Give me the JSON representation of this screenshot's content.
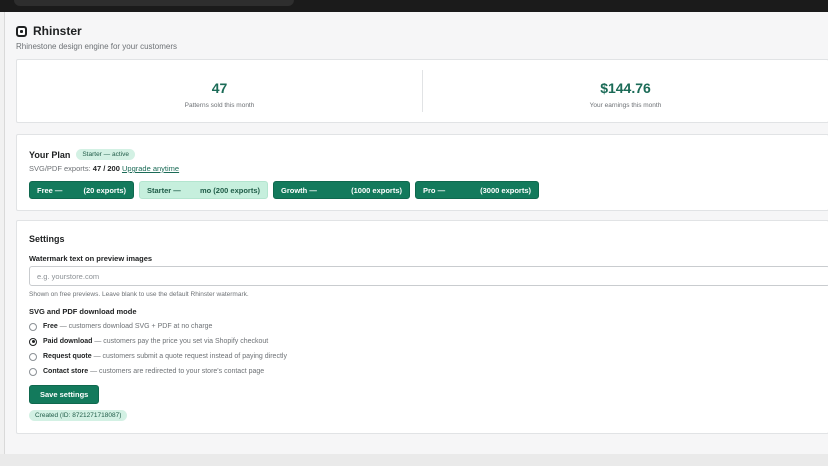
{
  "app": {
    "title": "Rhinster",
    "subtitle": "Rhinestone design engine for your customers"
  },
  "stats": [
    {
      "value": "47",
      "label": "Patterns sold this month"
    },
    {
      "value": "$144.76",
      "label": "Your earnings this month"
    }
  ],
  "plan": {
    "title": "Your Plan",
    "badge": "Starter — active",
    "exports_prefix": "SVG/PDF exports:",
    "exports_value": "47 / 200",
    "upgrade_link": "Upgrade anytime",
    "options": [
      {
        "name": "Free —",
        "detail": "(20 exports)",
        "active": false
      },
      {
        "name": "Starter —",
        "detail": "mo (200 exports)",
        "active": true
      },
      {
        "name": "Growth —",
        "detail": "(1000 exports)",
        "active": false
      },
      {
        "name": "Pro —",
        "detail": "(3000 exports)",
        "active": false
      }
    ]
  },
  "settings": {
    "title": "Settings",
    "watermark_label": "Watermark text on preview images",
    "watermark_value": "",
    "watermark_placeholder": "e.g. yourstore.com",
    "watermark_help": "Shown on free previews. Leave blank to use the default Rhinster watermark.",
    "mode_label": "SVG and PDF download mode",
    "modes": [
      {
        "name": "Free",
        "desc": " — customers download SVG + PDF at no charge",
        "checked": false
      },
      {
        "name": "Paid download",
        "desc": " — customers pay the price you set via Shopify checkout",
        "checked": true
      },
      {
        "name": "Request quote",
        "desc": " — customers submit a quote request instead of paying directly",
        "checked": false
      },
      {
        "name": "Contact store",
        "desc": " — customers are redirected to your store's contact page",
        "checked": false
      }
    ],
    "save_label": "Save settings",
    "created_badge": "Created (ID: 8721271718087)"
  },
  "colors": {
    "accent": "#137a5c",
    "accent_light": "#c6efdd",
    "stat_text": "#1b6b57"
  }
}
